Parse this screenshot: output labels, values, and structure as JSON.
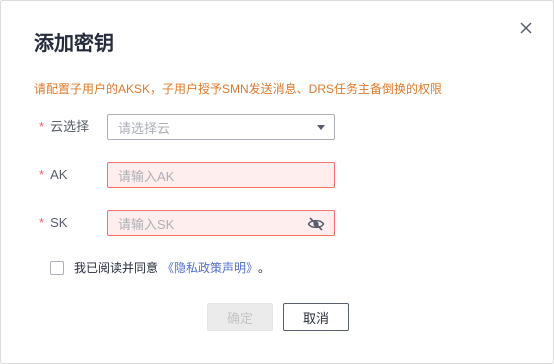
{
  "dialog": {
    "title": "添加密钥",
    "notice": "请配置子用户的AKSK，子用户授予SMN发送消息、DRS任务主备倒换的权限",
    "cloud": {
      "label": "云选择",
      "placeholder": "请选择云"
    },
    "ak": {
      "label": "AK",
      "placeholder": "请输入AK"
    },
    "sk": {
      "label": "SK",
      "placeholder": "请输入SK"
    },
    "required_mark": "*",
    "agree": {
      "text": "我已阅读并同意",
      "link": "《隐私政策声明》",
      "suffix": "。"
    },
    "buttons": {
      "ok": "确定",
      "cancel": "取消"
    }
  },
  "colors": {
    "notice": "#e07a2c",
    "required": "#f0646e",
    "error_border": "#f66f6a",
    "error_bg": "#ffeeed",
    "link": "#526ecc"
  }
}
